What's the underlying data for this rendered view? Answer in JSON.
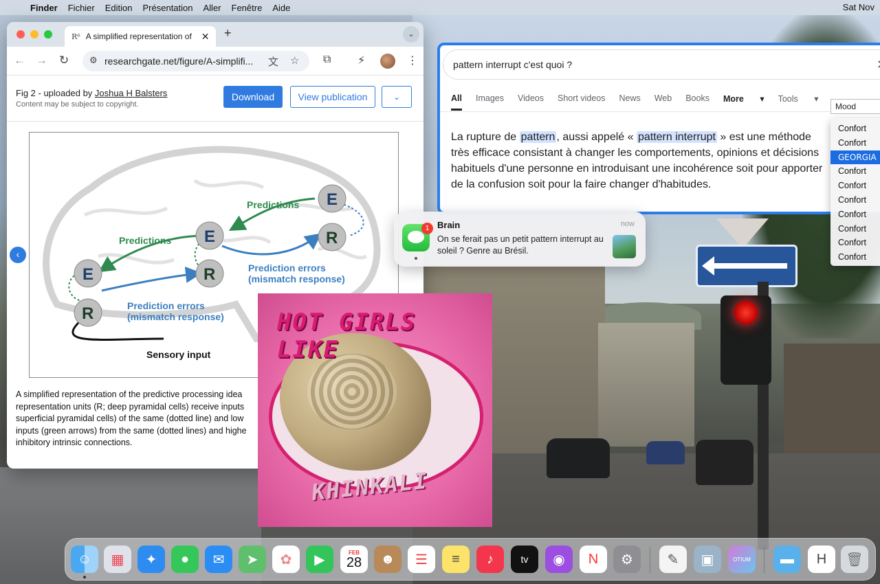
{
  "menubar": {
    "items": [
      "Finder",
      "Fichier",
      "Edition",
      "Présentation",
      "Aller",
      "Fenêtre",
      "Aide"
    ],
    "clock": "Sat Nov"
  },
  "browser": {
    "tab_title": "A simplified representation of",
    "tab_favicon": "R⁶",
    "url": "researchgate.net/figure/A-simplifi...",
    "figure_meta": {
      "prefix": "Fig 2 - uploaded by ",
      "uploader": "Joshua H Balsters",
      "note": "Content may be subject to copyright."
    },
    "buttons": {
      "download": "Download",
      "view_publication": "View publication"
    },
    "diagram": {
      "predictions_top": "Predictions",
      "predictions_left": "Predictions",
      "pred_errors_1": "Prediction errors",
      "pred_errors_1b": "(mismatch response)",
      "pred_errors_2": "Prediction errors",
      "pred_errors_2b": "(mismatch response)",
      "sensory": "Sensory input",
      "node_e": "E",
      "node_r": "R"
    },
    "caption": [
      "A simplified representation of the predictive processing idea",
      "representation units (R; deep pyramidal cells) receive inputs",
      "superficial pyramidal cells) of the same (dotted line) and low",
      "inputs (green arrows) from the same (dotted lines) and highe",
      "inhibitory intrinsic connections."
    ]
  },
  "google": {
    "query": "pattern interrupt c'est quoi ?",
    "tabs": [
      "All",
      "Images",
      "Videos",
      "Short videos",
      "News",
      "Web",
      "Books"
    ],
    "more": "More",
    "tools": "Tools",
    "snippet": {
      "t1": "La rupture de ",
      "h1": "pattern",
      "t2": ", aussi appelé « ",
      "h2": "pattern interrupt",
      "t3": " » est une méthode très efficace consistant à changer les comportements, opinions et décisions habituels d'une personne en introduisant une incohérence soit pour apporter de la confusion soit pour la faire changer d'habitudes."
    }
  },
  "font_picker": {
    "selected": "Mood",
    "options": [
      "Confort",
      "Confort",
      "GEORGIA",
      "Confort",
      "Confort",
      "Confort",
      "Confort",
      "Confort",
      "Confort",
      "Confort"
    ],
    "highlighted_index": 2
  },
  "notification": {
    "sender": "Brain",
    "time": "now",
    "badge": "1",
    "message": "On se ferait pas un petit pattern interrupt au soleil ? Genre au Brésil."
  },
  "meme": {
    "top_text": "HOT GIRLS LIKE",
    "bottom_text": "KHINKALI"
  },
  "dock": {
    "calendar_month": "FEB",
    "calendar_day": "28",
    "apps": [
      "finder-icon",
      "launchpad-icon",
      "safari-icon",
      "messages-icon",
      "mail-icon",
      "maps-icon",
      "photos-icon",
      "facetime-icon",
      "calendar-icon",
      "contacts-icon",
      "reminders-icon",
      "notes-icon",
      "music-icon",
      "tv-icon",
      "podcasts-icon",
      "news-icon",
      "system-settings-icon",
      "textedit-icon",
      "preview-icon",
      "otium-icon",
      "folder-icon",
      "document-icon",
      "trash-icon"
    ],
    "tv_label": "tv",
    "otium_label": "OTIUM"
  }
}
